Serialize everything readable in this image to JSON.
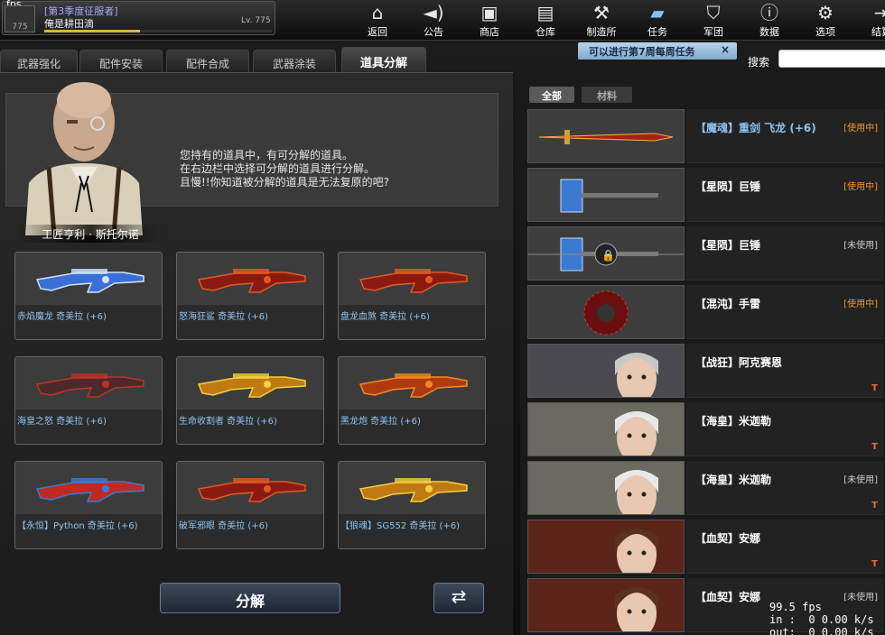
{
  "topbar": {
    "fps_label": "fps",
    "rank_badge": "775",
    "season": "[第3季度征服者]",
    "player_name": "俺是耕田滴",
    "level": "Lv. 775",
    "xp_progress": 0.42,
    "nav": [
      {
        "label": "返回",
        "icon": "home-icon"
      },
      {
        "label": "公告",
        "icon": "speaker-icon"
      },
      {
        "label": "商店",
        "icon": "shop-icon"
      },
      {
        "label": "仓库",
        "icon": "briefcase-icon"
      },
      {
        "label": "制造所",
        "icon": "hammer-icon"
      },
      {
        "label": "任务",
        "icon": "scroll-icon"
      },
      {
        "label": "军团",
        "icon": "shield-icon"
      },
      {
        "label": "数据",
        "icon": "info-icon"
      },
      {
        "label": "选项",
        "icon": "gear-icon"
      },
      {
        "label": "结算",
        "icon": "exit-icon"
      }
    ]
  },
  "notice": {
    "text": "可以进行第7周每周任务",
    "close": "×"
  },
  "search": {
    "label": "搜索",
    "placeholder": ""
  },
  "tabs": [
    "武器强化",
    "配件安装",
    "配件合成",
    "武器涂装",
    "道具分解"
  ],
  "npc": {
    "name": "工匠亨利 · 斯托尔诺",
    "dialog": [
      "您持有的道具中，有可分解的道具。",
      "在右边栏中选择可分解的道具进行分解。",
      "且慢!!你知道被分解的道具是无法复原的吧?"
    ]
  },
  "slots": [
    {
      "name": "赤焰魔龙 奇美拉 (+6)",
      "art": "blue"
    },
    {
      "name": "怒海狂鲨 奇美拉 (+6)",
      "art": "red"
    },
    {
      "name": "盘龙血煞 奇美拉 (+6)",
      "art": "red"
    },
    {
      "name": "海皇之怒 奇美拉 (+6)",
      "art": "dark"
    },
    {
      "name": "生命收割者 奇美拉 (+6)",
      "art": "gold"
    },
    {
      "name": "黑龙炮 奇美拉 (+6)",
      "art": "orange"
    },
    {
      "name": "【永恒】Python 奇美拉 (+6)",
      "art": "redblue"
    },
    {
      "name": "破军邪眼 奇美拉 (+6)",
      "art": "red"
    },
    {
      "name": "【狼魂】SG552 奇美拉 (+6)",
      "art": "gold"
    }
  ],
  "buttons": {
    "decompose": "分解",
    "refresh": "⇄"
  },
  "right_tabs": [
    "全部",
    "材料"
  ],
  "items": [
    {
      "name": "【魔魂】重剑 飞龙 (+6)",
      "status": "[使用中]",
      "status_color": "#f0962c",
      "thumb": "sword",
      "tmark": "",
      "highlight": true
    },
    {
      "name": "【星陨】巨锤",
      "status": "[使用中]",
      "status_color": "#f0962c",
      "thumb": "hammer",
      "tmark": "",
      "highlight": false
    },
    {
      "name": "【星陨】巨锤",
      "status": "[未使用]",
      "status_color": "#cccccc",
      "thumb": "hammer-locked",
      "tmark": "",
      "highlight": false
    },
    {
      "name": "【混沌】手雷",
      "status": "[使用中]",
      "status_color": "#f0962c",
      "thumb": "grenade",
      "tmark": "",
      "highlight": false
    },
    {
      "name": "【战狂】阿克赛恩",
      "status": "",
      "status_color": "#cccccc",
      "thumb": "char-dark",
      "tmark": "T",
      "highlight": false
    },
    {
      "name": "【海皇】米迦勒",
      "status": "",
      "status_color": "#cccccc",
      "thumb": "char-white",
      "tmark": "T",
      "highlight": false
    },
    {
      "name": "【海皇】米迦勒",
      "status": "[未使用]",
      "status_color": "#cccccc",
      "thumb": "char-white",
      "tmark": "T",
      "highlight": false
    },
    {
      "name": "【血契】安娜",
      "status": "",
      "status_color": "#cccccc",
      "thumb": "char-red",
      "tmark": "T",
      "highlight": false
    },
    {
      "name": "【血契】安娜",
      "status": "[未使用]",
      "status_color": "#cccccc",
      "thumb": "char-red",
      "tmark": "",
      "highlight": false
    }
  ],
  "netstats": [
    "99.5 fps",
    "in :  0 0.00 k/s",
    "out:  0 0.00 k/s"
  ]
}
